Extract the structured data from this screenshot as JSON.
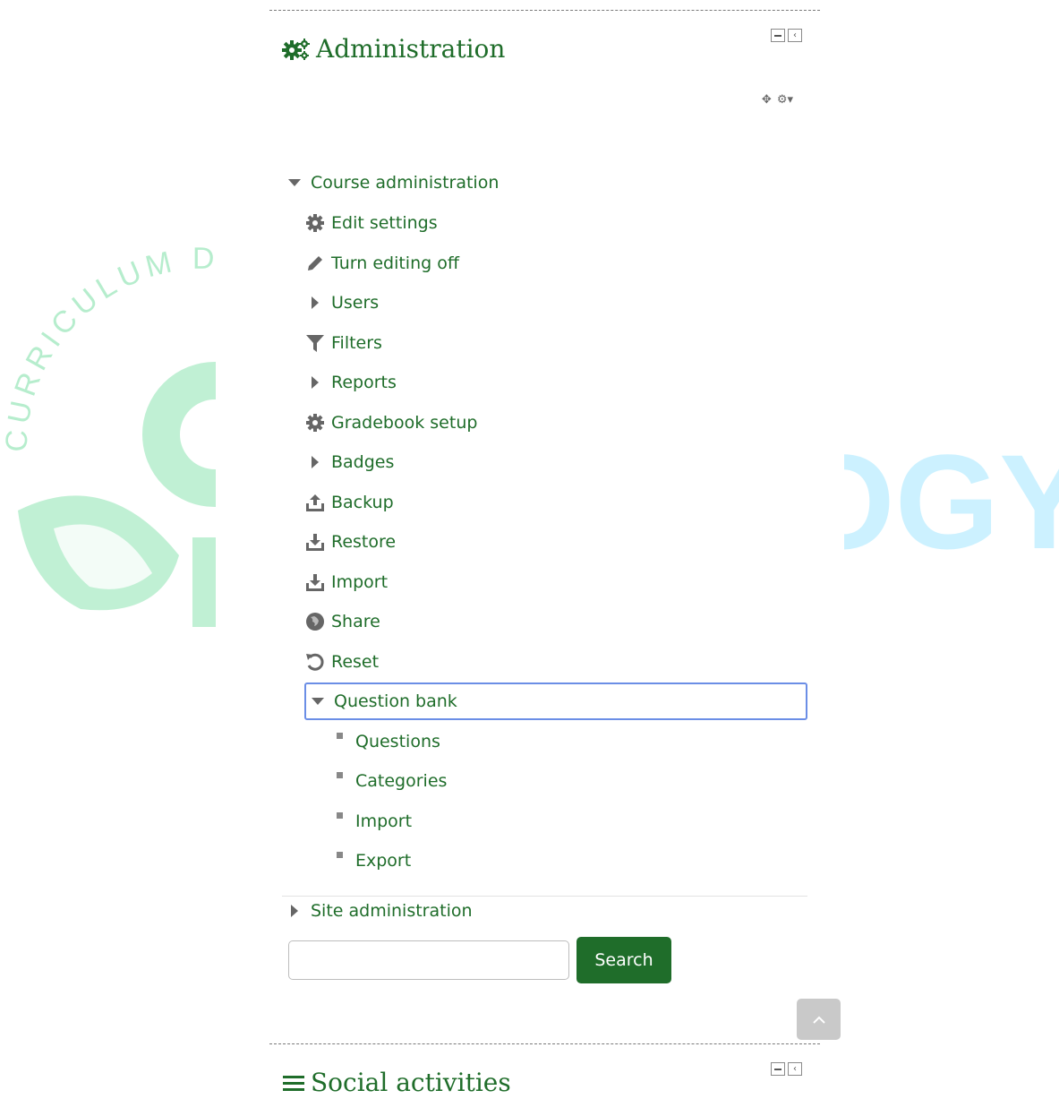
{
  "watermark": {
    "arc_text": "CURRICULUM D",
    "right_text": "OGY",
    "green": "#2ecc71",
    "cyan": "#4dd0ff"
  },
  "admin": {
    "title": "Administration",
    "title_icon": "cogs-icon",
    "controls": [
      "minus-icon",
      "dock-icon"
    ],
    "tools": [
      "move-icon",
      "cog-menu-icon"
    ]
  },
  "tree": {
    "course_admin": "Course administration",
    "items": [
      {
        "label": "Edit settings",
        "icon": "gear-icon"
      },
      {
        "label": "Turn editing off",
        "icon": "pencil-icon"
      },
      {
        "label": "Users",
        "icon": "expand-arrow-icon"
      },
      {
        "label": "Filters",
        "icon": "filter-icon"
      },
      {
        "label": "Reports",
        "icon": "expand-arrow-icon"
      },
      {
        "label": "Gradebook setup",
        "icon": "gear-icon"
      },
      {
        "label": "Badges",
        "icon": "expand-arrow-icon"
      },
      {
        "label": "Backup",
        "icon": "upload-icon"
      },
      {
        "label": "Restore",
        "icon": "download-icon"
      },
      {
        "label": "Import",
        "icon": "download-icon"
      },
      {
        "label": "Share",
        "icon": "globe-icon"
      },
      {
        "label": "Reset",
        "icon": "reset-icon"
      }
    ],
    "question_bank": "Question bank",
    "question_bank_items": [
      "Questions",
      "Categories",
      "Import",
      "Export"
    ],
    "site_admin": "Site administration"
  },
  "search": {
    "value": "",
    "button": "Search"
  },
  "social": {
    "title": "Social activities",
    "title_icon": "menu-icon"
  },
  "colors": {
    "accent": "#1f6d2a",
    "focus": "#6b8ee6",
    "icon": "#666666"
  }
}
